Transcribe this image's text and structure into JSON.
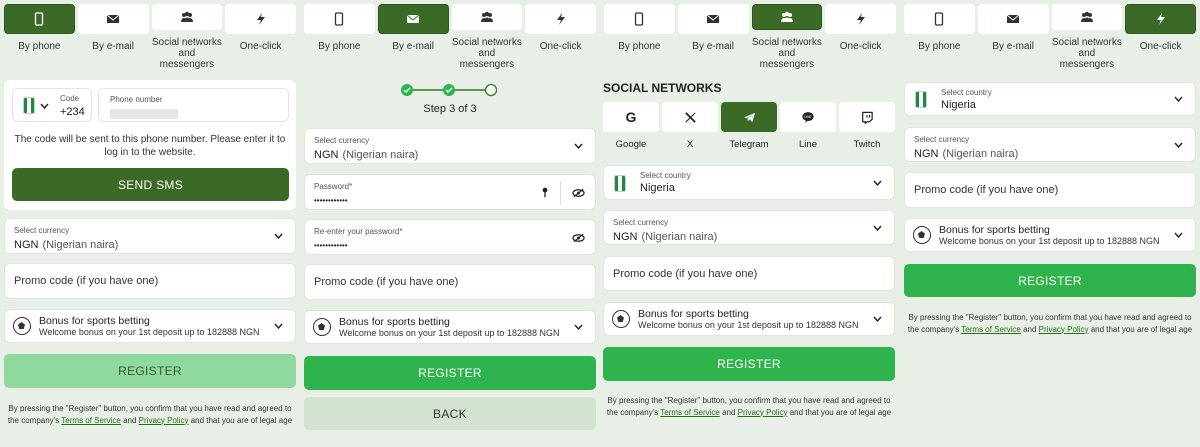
{
  "tabs": [
    {
      "label": "By phone",
      "icon": "phone-icon"
    },
    {
      "label": "By e-mail",
      "icon": "mail-icon"
    },
    {
      "label": "Social networks and messengers",
      "icon": "people-icon"
    },
    {
      "label": "One-click",
      "icon": "lightning-icon"
    }
  ],
  "labels": {
    "tab_phone": "By phone",
    "tab_email": "By e-mail",
    "tab_social_1": "Social networks",
    "tab_social_2": "and messengers",
    "tab_oneclick": "One-click"
  },
  "colors": {
    "active_tab": "#3b6a27",
    "register_green": "#2fb34c",
    "register_disabled": "#8fd99f",
    "background": "#e8efe6"
  },
  "phone_form": {
    "code_label": "Code",
    "code_value": "+234",
    "phone_label": "Phone number",
    "hint": "The code will be sent to this phone number. Please enter it to log in to the website.",
    "send_sms": "SEND SMS"
  },
  "currency": {
    "label": "Select currency",
    "code": "NGN",
    "name": "(Nigerian naira)"
  },
  "country": {
    "label": "Select country",
    "value": "Nigeria"
  },
  "promo_placeholder": "Promo code (if you have one)",
  "bonus": {
    "title": "Bonus for sports betting",
    "subtitle": "Welcome bonus on your 1st deposit up to 182888 NGN"
  },
  "register": "REGISTER",
  "back": "BACK",
  "email_form": {
    "step": "Step 3 of 3",
    "password_label": "Password*",
    "password_value": "••••••••••••",
    "reenter_label": "Re-enter your password*",
    "reenter_value": "••••••••••••"
  },
  "social": {
    "heading": "SOCIAL NETWORKS",
    "networks": [
      {
        "name": "Google",
        "icon": "google-icon"
      },
      {
        "name": "X",
        "icon": "x-icon"
      },
      {
        "name": "Telegram",
        "icon": "telegram-icon"
      },
      {
        "name": "Line",
        "icon": "line-icon"
      },
      {
        "name": "Twitch",
        "icon": "twitch-icon"
      }
    ]
  },
  "legal": {
    "prefix": "By pressing the \"Register\" button, you confirm that you have read and agreed to the company's ",
    "tos": "Terms of Service",
    "and": " and ",
    "privacy": "Privacy Policy",
    "suffix": " and that you are of legal age"
  }
}
